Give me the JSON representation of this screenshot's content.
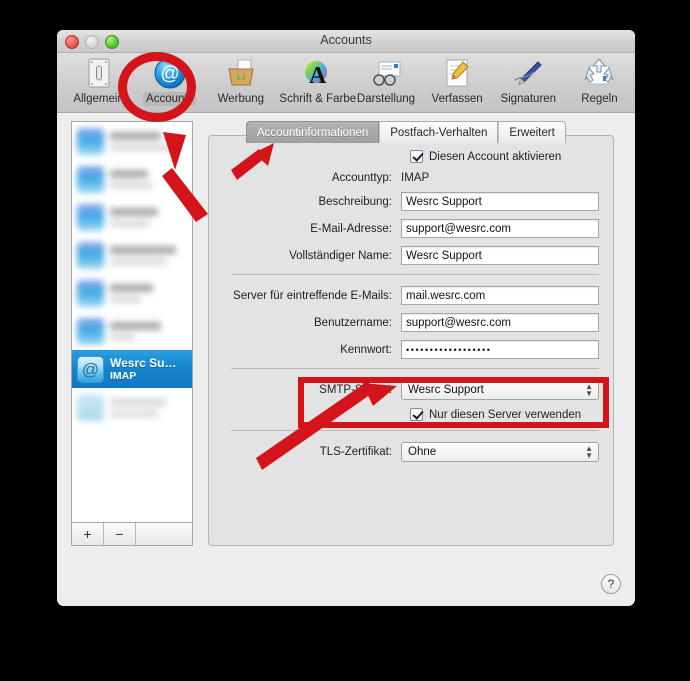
{
  "window": {
    "title": "Accounts",
    "traffic_lights": [
      "close-button",
      "minimize-button",
      "zoom-button"
    ]
  },
  "toolbar": {
    "items": [
      {
        "label": "Allgemein",
        "icon": "general-switch-icon",
        "selected": false
      },
      {
        "label": "Accounts",
        "icon": "at-sign-icon",
        "selected": true
      },
      {
        "label": "Werbung",
        "icon": "junk-mail-bin-icon",
        "selected": false
      },
      {
        "label": "Schrift & Farbe",
        "icon": "font-color-a-icon",
        "selected": false
      },
      {
        "label": "Darstellung",
        "icon": "viewing-glasses-icon",
        "selected": false
      },
      {
        "label": "Verfassen",
        "icon": "compose-pencil-icon",
        "selected": false
      },
      {
        "label": "Signaturen",
        "icon": "signature-pen-icon",
        "selected": false
      },
      {
        "label": "Regeln",
        "icon": "rules-arrows-icon",
        "selected": false
      }
    ]
  },
  "sidebar": {
    "accounts": [
      {
        "name": "",
        "type": "",
        "blurred": true
      },
      {
        "name": "",
        "type": "",
        "blurred": true
      },
      {
        "name": "",
        "type": "",
        "blurred": true
      },
      {
        "name": "",
        "type": "",
        "blurred": true
      },
      {
        "name": "",
        "type": "",
        "blurred": true
      },
      {
        "name": "",
        "type": "",
        "blurred": true
      },
      {
        "name": "Wesrc Su…",
        "type": "IMAP",
        "blurred": false,
        "selected": true
      },
      {
        "name": "",
        "type": "",
        "blurred": true
      }
    ],
    "selected_account": {
      "name": "Wesrc Su…",
      "type": "IMAP"
    },
    "add_button": "+",
    "remove_button": "−"
  },
  "tabs": [
    {
      "label": "Accountinformationen",
      "active": true
    },
    {
      "label": "Postfach-Verhalten",
      "active": false
    },
    {
      "label": "Erweitert",
      "active": false
    }
  ],
  "form": {
    "enable_account": {
      "label": "Diesen Account aktivieren",
      "checked": true
    },
    "account_type": {
      "label": "Accounttyp:",
      "value": "IMAP"
    },
    "description": {
      "label": "Beschreibung:",
      "value": "Wesrc Support"
    },
    "email": {
      "label": "E-Mail-Adresse:",
      "value": "support@wesrc.com"
    },
    "full_name": {
      "label": "Vollständiger Name:",
      "value": "Wesrc Support"
    },
    "incoming_server": {
      "label": "Server für eintreffende E-Mails:",
      "value": "mail.wesrc.com"
    },
    "username": {
      "label": "Benutzername:",
      "value": "support@wesrc.com"
    },
    "password": {
      "label": "Kennwort:",
      "value": "••••••••••••••••••"
    },
    "smtp_server": {
      "label": "SMTP-Server:",
      "value": "Wesrc Support"
    },
    "only_this_server": {
      "label": "Nur diesen Server verwenden",
      "checked": true
    },
    "tls_certificate": {
      "label": "TLS-Zertifikat:",
      "value": "Ohne"
    }
  },
  "help_button": "?",
  "annotations": {
    "highlight_color": "#d3141b",
    "circle_target": "accounts-toolbar-item",
    "box_target": "smtp-server-section",
    "arrows": [
      {
        "name": "arrow-to-accounts-toolbar-item"
      },
      {
        "name": "arrow-to-accountinformationen-tab"
      },
      {
        "name": "arrow-to-smtp-server-popup"
      }
    ]
  }
}
